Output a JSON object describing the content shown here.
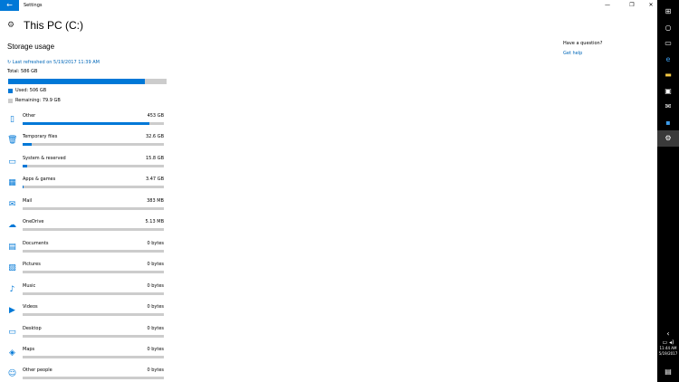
{
  "window": {
    "title": "Settings",
    "back_glyph": "←",
    "min_glyph": "—",
    "max_glyph": "❐",
    "close_glyph": "✕"
  },
  "header": {
    "icon": "gear-icon",
    "title": "This PC (C:)"
  },
  "storage": {
    "section_title": "Storage usage",
    "refresh_text": "↻ Last refreshed on 5/19/2017 11:39 AM",
    "total_text": "Total: 586 GB",
    "used_fraction": 0.8635,
    "used_text": "Used: 506 GB",
    "remaining_text": "Remaining: 79.9 GB",
    "accent_color": "#0078d7",
    "track_color": "#cccccc"
  },
  "categories": [
    {
      "name": "Other",
      "size": "453 GB",
      "fraction": 0.895,
      "icon": "other-file-icon",
      "glyph": "▯"
    },
    {
      "name": "Temporary files",
      "size": "32.6 GB",
      "fraction": 0.064,
      "icon": "trash-icon",
      "glyph": "🗑"
    },
    {
      "name": "System & reserved",
      "size": "15.8 GB",
      "fraction": 0.031,
      "icon": "laptop-icon",
      "glyph": "▭"
    },
    {
      "name": "Apps & games",
      "size": "3.47 GB",
      "fraction": 0.007,
      "icon": "apps-icon",
      "glyph": "▦"
    },
    {
      "name": "Mail",
      "size": "383 MB",
      "fraction": 0.0,
      "icon": "mail-icon",
      "glyph": "✉"
    },
    {
      "name": "OneDrive",
      "size": "5.13 MB",
      "fraction": 0.0,
      "icon": "cloud-icon",
      "glyph": "☁"
    },
    {
      "name": "Documents",
      "size": "0 bytes",
      "fraction": 0.0,
      "icon": "documents-icon",
      "glyph": "▤"
    },
    {
      "name": "Pictures",
      "size": "0 bytes",
      "fraction": 0.0,
      "icon": "pictures-icon",
      "glyph": "▨"
    },
    {
      "name": "Music",
      "size": "0 bytes",
      "fraction": 0.0,
      "icon": "music-icon",
      "glyph": "♪"
    },
    {
      "name": "Videos",
      "size": "0 bytes",
      "fraction": 0.0,
      "icon": "video-icon",
      "glyph": "▶"
    },
    {
      "name": "Desktop",
      "size": "0 bytes",
      "fraction": 0.0,
      "icon": "desktop-icon",
      "glyph": "▭"
    },
    {
      "name": "Maps",
      "size": "0 bytes",
      "fraction": 0.0,
      "icon": "maps-icon",
      "glyph": "◈"
    },
    {
      "name": "Other people",
      "size": "0 bytes",
      "fraction": 0.0,
      "icon": "people-icon",
      "glyph": "☺"
    }
  ],
  "help": {
    "question": "Have a question?",
    "link": "Get help"
  },
  "taskbar": {
    "items": [
      {
        "name": "start-icon",
        "glyph": "⊞"
      },
      {
        "name": "cortana-icon",
        "glyph": "○"
      },
      {
        "name": "task-view-icon",
        "glyph": "▭"
      },
      {
        "name": "edge-icon",
        "glyph": "e"
      },
      {
        "name": "file-explorer-icon",
        "glyph": "▬"
      },
      {
        "name": "store-icon",
        "glyph": "▣"
      },
      {
        "name": "mail-app-icon",
        "glyph": "✉"
      },
      {
        "name": "outlook-icon",
        "glyph": "▪"
      },
      {
        "name": "settings-app-icon",
        "glyph": "⚙"
      }
    ],
    "time": "11:44 AM",
    "date": "5/19/2017"
  }
}
